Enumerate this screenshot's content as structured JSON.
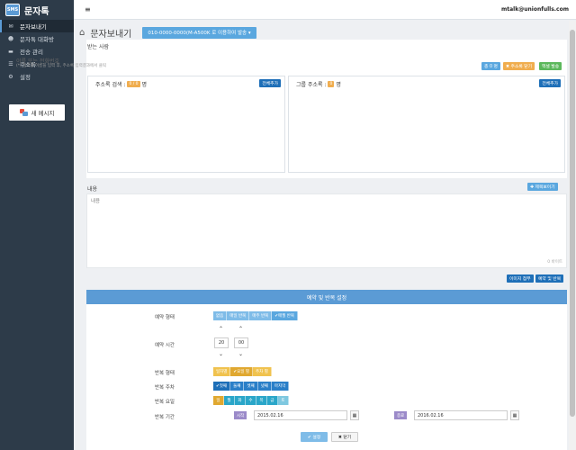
{
  "app": {
    "logo_box": "SMS",
    "name": "문자톡"
  },
  "sidebar": {
    "items": [
      {
        "label": "문자보내기",
        "icon": "send-icon",
        "active": true
      },
      {
        "label": "문자톡 대화방",
        "icon": "chat-icon",
        "active": false
      },
      {
        "label": "전송 관리",
        "icon": "folder-icon",
        "active": false
      },
      {
        "label": "주소록",
        "icon": "list-icon",
        "active": false
      },
      {
        "label": "설정",
        "icon": "gear-icon",
        "active": false
      }
    ],
    "new_message": "새 메시지"
  },
  "topbar": {
    "menu_icon": "≡",
    "user_email": "mtalk@unionfulls.com"
  },
  "page": {
    "title": "문자보내기",
    "sender_button": "010-0000-0000(M-A500K 로 이용하여 발송 ▾"
  },
  "recipients": {
    "label": "받는 사람",
    "input_placeholder": "이름 또는 전화번호",
    "hint": "(*) 입력할 이름을 입력 후, 주소록 입력결과에서 클릭",
    "count_button": "총 0 명",
    "addressbook_close_button": "✖ 주소록 닫기",
    "excel_button": "엑셀 발송",
    "address_panel": {
      "title": "주소록 검색 :",
      "count": "0 / 0",
      "unit": "명",
      "add_all": "전체추가"
    },
    "group_panel": {
      "title": "그룹 주소록 :",
      "count": "0",
      "unit": "명",
      "add_all": "전체추가"
    }
  },
  "message": {
    "label": "내용",
    "recent_button": "✚ 제목보이기",
    "placeholder": "내용",
    "byte_count": "0 바이트",
    "image_button": "이미지 첨부",
    "reserve_button": "예약 및 반복"
  },
  "reservation": {
    "header": "예약 및 반복 설정",
    "type_label": "예약 형태",
    "type_options": [
      "없음",
      "매일 반복",
      "매주 반복",
      "✔매월 반복"
    ],
    "time_label": "예약 시간",
    "hour": "20",
    "minute": "00",
    "repeat_type_label": "반복 형태",
    "repeat_type_options": [
      "일자별",
      "✔요일 별",
      "주차 별"
    ],
    "repeat_week_label": "반복 주차",
    "repeat_week_options": [
      "✔첫째",
      "둘째",
      "셋째",
      "넷째",
      "마지막"
    ],
    "repeat_day_label": "반복 요일",
    "repeat_day_options": [
      "일",
      "월",
      "화",
      "수",
      "목",
      "금",
      "토"
    ],
    "period_label": "반복 기간",
    "start_tag": "시작",
    "start_date": "2015.02.16",
    "end_tag": "종료",
    "end_date": "2016.02.16",
    "confirm_button": "✔ 설정",
    "close_button": "✖ 닫기"
  },
  "colors": {
    "sidebar": "#2d3b49",
    "accent": "#5b9bd5",
    "orange": "#f0ad4e",
    "green": "#5cb85c",
    "blue_dark": "#1e6fb8",
    "teal": "#2aa6c9",
    "purple": "#9b8ac9"
  }
}
